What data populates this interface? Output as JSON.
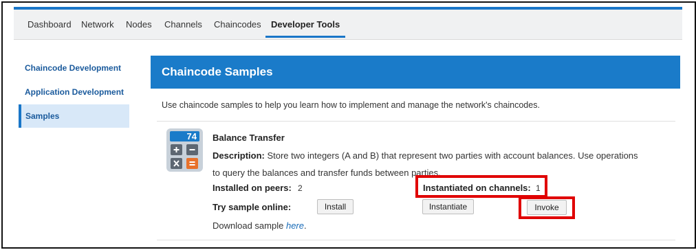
{
  "nav": {
    "tabs": [
      {
        "label": "Dashboard"
      },
      {
        "label": "Network"
      },
      {
        "label": "Nodes"
      },
      {
        "label": "Channels"
      },
      {
        "label": "Chaincodes"
      },
      {
        "label": "Developer Tools",
        "active": true
      }
    ]
  },
  "sidebar": {
    "items": [
      {
        "label": "Chaincode Development"
      },
      {
        "label": "Application Development"
      },
      {
        "label": "Samples",
        "active": true
      }
    ]
  },
  "main": {
    "title": "Chaincode Samples",
    "intro": "Use chaincode samples to help you learn how to implement and manage the network's chaincodes.",
    "sample": {
      "icon_number": "74",
      "name": "Balance Transfer",
      "description_label": "Description:",
      "description": "Store two integers (A and B) that represent two parties with account balances. Use operations to query the balances and transfer funds between parties.",
      "installed_label": "Installed on peers:",
      "installed_value": "2",
      "instantiated_label": "Instantiated on channels:",
      "instantiated_value": "1",
      "try_label": "Try sample online:",
      "install_button": "Install",
      "instantiate_button": "Instantiate",
      "invoke_button": "Invoke",
      "download_prefix": "Download sample",
      "download_link": "here",
      "download_suffix": "."
    }
  },
  "colors": {
    "accent": "#1976c8",
    "header": "#1a7bc9",
    "highlight": "#e00000"
  }
}
